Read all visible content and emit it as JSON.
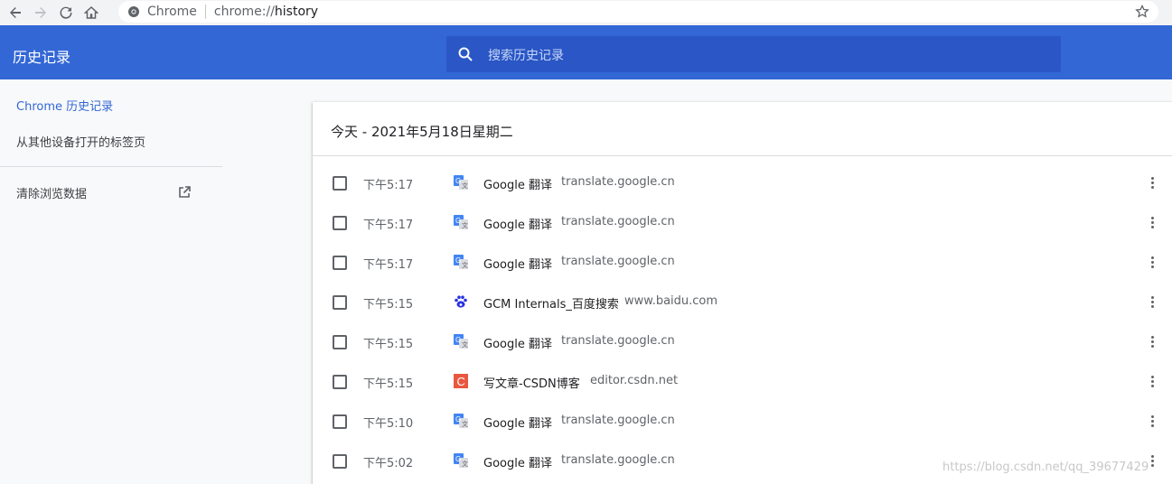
{
  "browser": {
    "site_label": "Chrome",
    "url_prefix": "chrome://",
    "url_path": "history"
  },
  "header": {
    "title": "历史记录",
    "search_placeholder": "搜索历史记录"
  },
  "sidebar": {
    "items": [
      {
        "label": "Chrome 历史记录",
        "active": true
      },
      {
        "label": "从其他设备打开的标签页",
        "active": false
      },
      {
        "label": "清除浏览数据",
        "active": false
      }
    ]
  },
  "main": {
    "date_heading": "今天 - 2021年5月18日星期二",
    "entries": [
      {
        "time": "下午5:17",
        "title": "Google 翻译",
        "domain": "translate.google.cn",
        "favicon": "google-translate-icon"
      },
      {
        "time": "下午5:17",
        "title": "Google 翻译",
        "domain": "translate.google.cn",
        "favicon": "google-translate-icon"
      },
      {
        "time": "下午5:17",
        "title": "Google 翻译",
        "domain": "translate.google.cn",
        "favicon": "google-translate-icon"
      },
      {
        "time": "下午5:15",
        "title": "GCM Internals_百度搜索",
        "domain": "www.baidu.com",
        "favicon": "baidu-paw-icon"
      },
      {
        "time": "下午5:15",
        "title": "Google 翻译",
        "domain": "translate.google.cn",
        "favicon": "google-translate-icon"
      },
      {
        "time": "下午5:15",
        "title": "写文章-CSDN博客",
        "domain": "editor.csdn.net",
        "favicon": "csdn-icon"
      },
      {
        "time": "下午5:10",
        "title": "Google 翻译",
        "domain": "translate.google.cn",
        "favicon": "google-translate-icon"
      },
      {
        "time": "下午5:02",
        "title": "Google 翻译",
        "domain": "translate.google.cn",
        "favicon": "google-translate-icon"
      }
    ]
  },
  "watermark": "https://blog.csdn.net/qq_39677429",
  "colors": {
    "header_blue": "#3367d6",
    "search_blue": "#2a56c6",
    "accent": "#3367d6",
    "csdn_red": "#e9573f"
  }
}
